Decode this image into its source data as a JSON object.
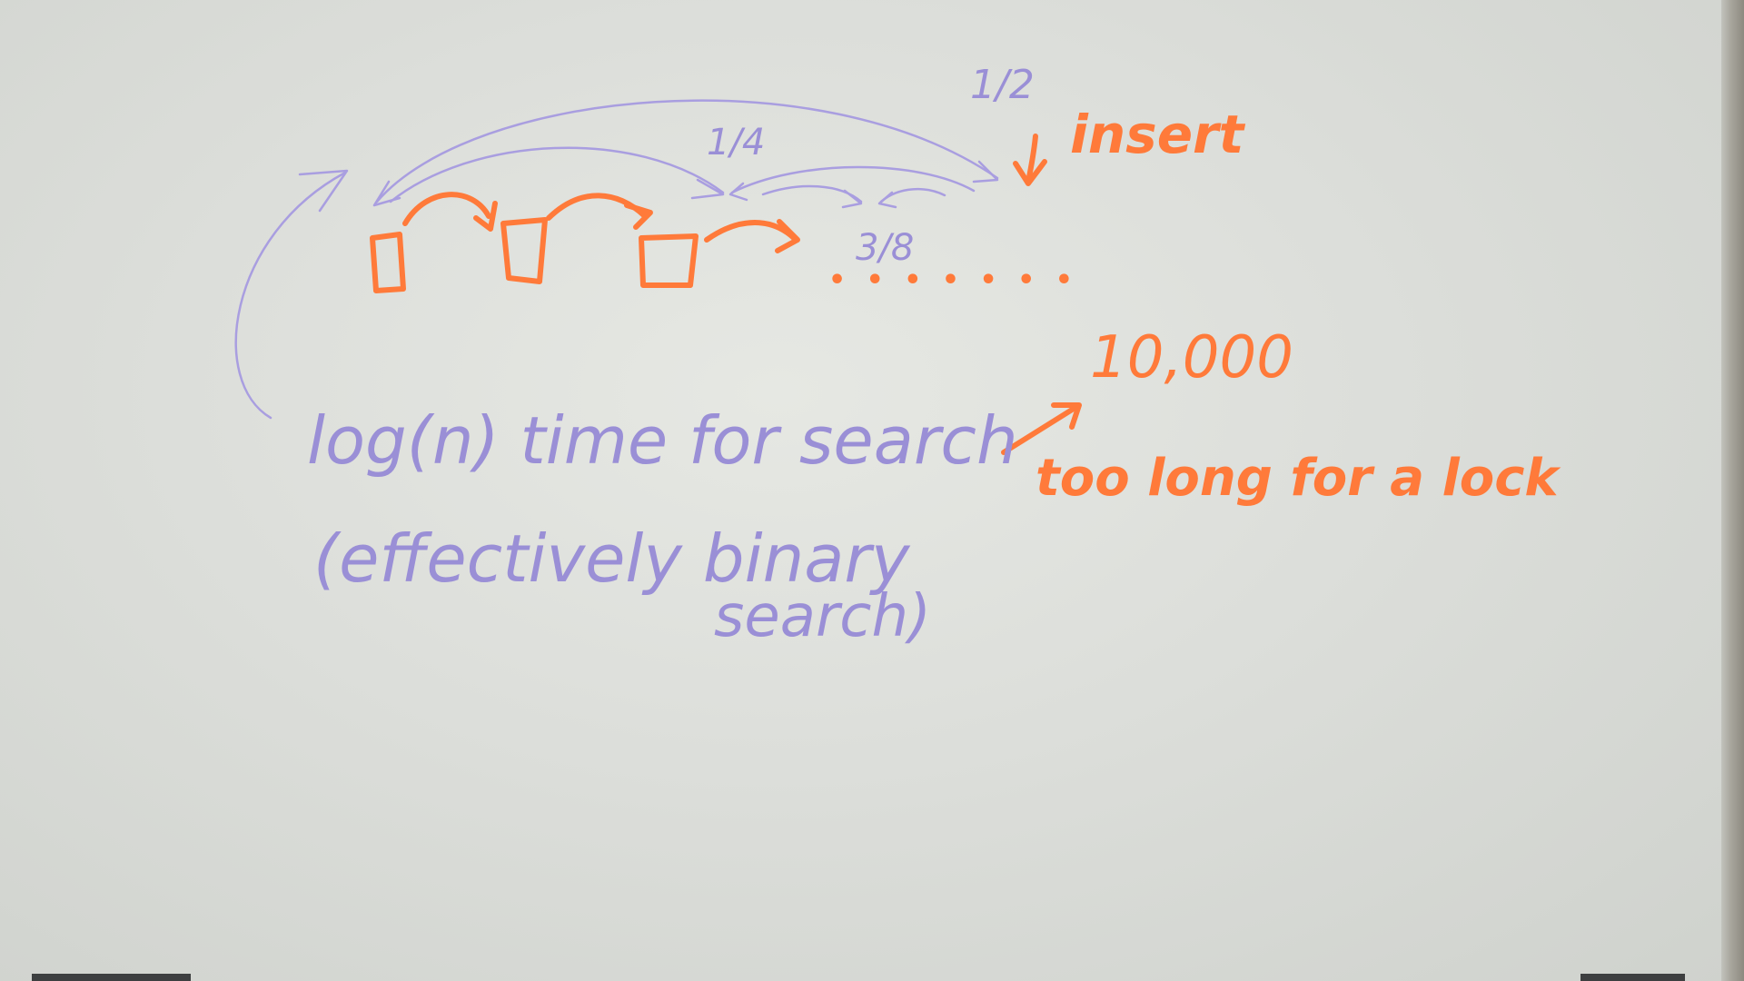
{
  "board": {
    "colors": {
      "purple_marker": "#9a8fd6",
      "orange_marker": "#ff7a3a",
      "surface": "#e2e4df"
    }
  },
  "labels": {
    "half": "1/2",
    "quarter": "1/4",
    "three_eighths": "3/8",
    "insert": "insert",
    "dots": "• • • • • • •",
    "count": "10,000",
    "too_long": "too long for a lock",
    "search_line1": "log(n) time for search",
    "search_line2": "(effectively binary",
    "search_line3": "search)"
  }
}
